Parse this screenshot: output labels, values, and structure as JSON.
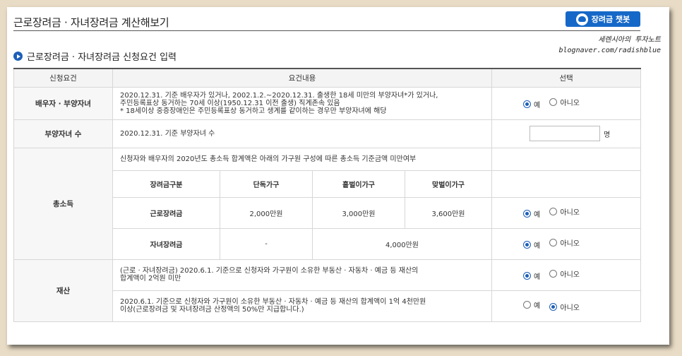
{
  "page_title": "근로장려금 · 자녀장려금 계산해보기",
  "chatbot_button": "장려금 챗봇",
  "watermark": {
    "line1": "세렌시아의 투자노트",
    "line2": "blognaver.com/radishblue"
  },
  "section_title": "근로장려금 · 자녀장려금 신청요건 입력",
  "table": {
    "headers": [
      "신청요건",
      "요건내용",
      "선택"
    ],
    "radio_yes": "예",
    "radio_no": "아니오",
    "spouse": {
      "label": "배우자 · 부양자녀",
      "line1": "2020.12.31. 기준 배우자가 있거나, 2002.1.2.~2020.12.31. 출생한 18세 미만의 부양자녀*가 있거나,",
      "line2": "주민등록표상 동거하는 70세 이상(1950.12.31 이전 출생) 직계존속 있음",
      "line3": "* 18세이상 중증장애인은 주민등록표상 동거하고 생계를 같이하는 경우만 부양자녀에 해당"
    },
    "children": {
      "label": "부양자녀 수",
      "content": "2020.12.31. 기준 부양자녀 수",
      "unit": "명"
    },
    "income": {
      "label": "총소득",
      "desc": "신청자와 배우자의 2020년도 총소득 합계액은 아래의 가구원 구성에 따른 총소득 기준금액 미만여부",
      "sub_headers": [
        "장려금구분",
        "단독가구",
        "홑벌이가구",
        "맞벌이가구"
      ],
      "row1": {
        "type": "근로장려금",
        "single": "2,000만원",
        "one": "3,000만원",
        "dual": "3,600만원"
      },
      "row2": {
        "type": "자녀장려금",
        "single": "-",
        "combined": "4,000만원"
      }
    },
    "assets": {
      "label": "재산",
      "a_line1": "(근로 · 자녀장려금) 2020.6.1. 기준으로 신청자와 가구원이 소유한 부동산 · 자동차 · 예금 등 재산의",
      "a_line2": "합계액이 2억원 미만",
      "b_line1": "2020.6.1. 기준으로 신청자와 가구원이 소유한 부동산 · 자동차 · 예금 등 재산의 합계액이 1억 4천만원",
      "b_line2": "이상(근로장려금 및 자녀장려금 산정액의 50%만 지급합니다.)"
    }
  }
}
